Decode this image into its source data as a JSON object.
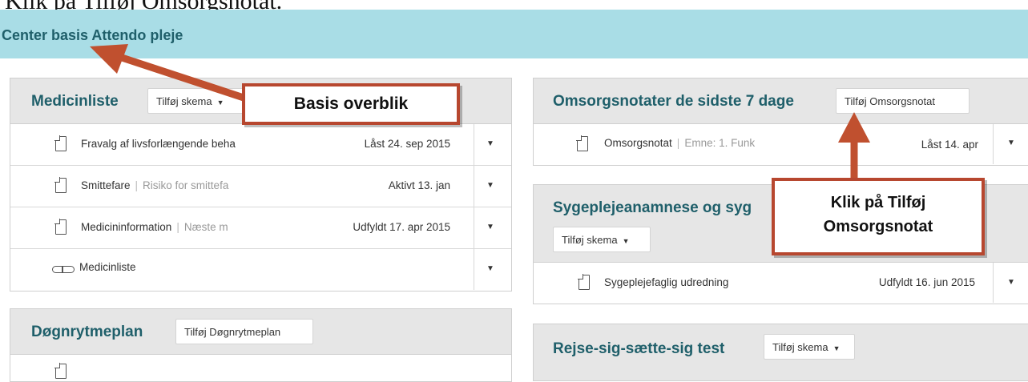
{
  "caption": "Klik på Tilføj Omsorgsnotat.",
  "header": {
    "title": "Center basis Attendo pleje"
  },
  "medicinliste": {
    "title": "Medicinliste",
    "add_label": "Tilføj skema",
    "rows": [
      {
        "label": "Fravalg af livsforlængende beha",
        "sub": "",
        "status": "Låst 24. sep 2015",
        "icon": "document-icon"
      },
      {
        "label": "Smittefare",
        "sub": "Risiko for smittefa",
        "status": "Aktivt 13. jan",
        "icon": "document-icon"
      },
      {
        "label": "Medicininformation",
        "sub": "Næste m",
        "status": "Udfyldt 17. apr 2015",
        "icon": "document-icon"
      },
      {
        "label": "Medicinliste",
        "sub": "",
        "status": "",
        "icon": "pill-icon"
      }
    ]
  },
  "dognrytmeplan": {
    "title": "Døgnrytmeplan",
    "add_label": "Tilføj Døgnrytmeplan"
  },
  "omsorgsnotater": {
    "title": "Omsorgsnotater de sidste 7 dage",
    "add_label": "Tilføj Omsorgsnotat",
    "rows": [
      {
        "label": "Omsorgsnotat",
        "sub": "Emne: 1. Funk",
        "status": "Låst 14. apr",
        "icon": "document-icon"
      }
    ]
  },
  "sygepleje": {
    "title": "Sygeplejeanamnese og syg",
    "add_label": "Tilføj skema",
    "rows": [
      {
        "label": "Sygeplejefaglig udredning",
        "sub": "",
        "status": "Udfyldt 16. jun 2015",
        "icon": "document-icon"
      }
    ]
  },
  "rejse": {
    "title": "Rejse-sig-sætte-sig test",
    "add_label": "Tilføj skema"
  },
  "callouts": {
    "basis": "Basis overblik",
    "klik_line1": "Klik på Tilføj",
    "klik_line2": "Omsorgsnotat"
  },
  "colors": {
    "header_bg": "#a9dde6",
    "title": "#1f5f6a",
    "callout_border": "#b7472f",
    "arrow": "#c0502f"
  }
}
